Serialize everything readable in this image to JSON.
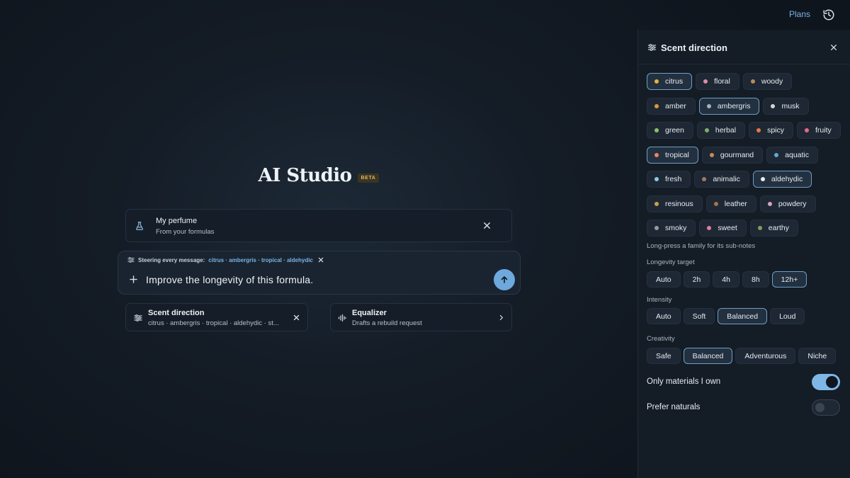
{
  "topbar": {
    "plans_label": "Plans",
    "history_icon": "history-icon"
  },
  "hero": {
    "title": "AI Studio",
    "badge": "BETA"
  },
  "perfume_card": {
    "title": "My perfume",
    "subtitle": "From your formulas",
    "icon": "flask-icon"
  },
  "composer": {
    "steer_label": "Steering every message:",
    "steer_values": "citrus · ambergris · tropical · aldehydic",
    "input_value": "Improve the longevity of this formula.",
    "send_icon": "arrow-up-icon"
  },
  "scent_card": {
    "title": "Scent direction",
    "subtitle": "citrus · ambergris · tropical · aldehydic · st..."
  },
  "equalizer_card": {
    "title": "Equalizer",
    "subtitle": "Drafts a rebuild request"
  },
  "panel": {
    "title": "Scent direction",
    "families": [
      [
        {
          "label": "citrus",
          "color": "#e3b341",
          "selected": true
        },
        {
          "label": "floral",
          "color": "#e08aa8",
          "selected": false
        },
        {
          "label": "woody",
          "color": "#b98a5e",
          "selected": false
        }
      ],
      [
        {
          "label": "amber",
          "color": "#d99a3e",
          "selected": false
        },
        {
          "label": "ambergris",
          "color": "#9fb4c6",
          "selected": true
        },
        {
          "label": "musk",
          "color": "#d8d3cc",
          "selected": false
        }
      ],
      [
        {
          "label": "green",
          "color": "#8cc06a",
          "selected": false
        },
        {
          "label": "herbal",
          "color": "#7fae6a",
          "selected": false
        },
        {
          "label": "spicy",
          "color": "#e0794a",
          "selected": false
        },
        {
          "label": "fruity",
          "color": "#e66a7e",
          "selected": false
        }
      ],
      [
        {
          "label": "tropical",
          "color": "#e88466",
          "selected": true
        },
        {
          "label": "gourmand",
          "color": "#c98a56",
          "selected": false
        },
        {
          "label": "aquatic",
          "color": "#5fa8d8",
          "selected": false
        }
      ],
      [
        {
          "label": "fresh",
          "color": "#8ec9e6",
          "selected": false
        },
        {
          "label": "animalic",
          "color": "#a07a62",
          "selected": false
        },
        {
          "label": "aldehydic",
          "color": "#e9edf2",
          "selected": true
        }
      ],
      [
        {
          "label": "resinous",
          "color": "#c7a04a",
          "selected": false
        },
        {
          "label": "leather",
          "color": "#a8704a",
          "selected": false
        },
        {
          "label": "powdery",
          "color": "#d7a3c6",
          "selected": false
        }
      ],
      [
        {
          "label": "smoky",
          "color": "#9a9a9a",
          "selected": false
        },
        {
          "label": "sweet",
          "color": "#e27f9e",
          "selected": false
        },
        {
          "label": "earthy",
          "color": "#8a9a5e",
          "selected": false
        }
      ]
    ],
    "hint": "Long-press a family for its sub-notes",
    "longevity": {
      "label": "Longevity target",
      "options": [
        "Auto",
        "2h",
        "4h",
        "8h",
        "12h+"
      ],
      "selected": "12h+"
    },
    "intensity": {
      "label": "Intensity",
      "options": [
        "Auto",
        "Soft",
        "Balanced",
        "Loud"
      ],
      "selected": "Balanced"
    },
    "creativity": {
      "label": "Creativity",
      "options": [
        "Safe",
        "Balanced",
        "Adventurous",
        "Niche"
      ],
      "selected": "Balanced"
    },
    "toggles": [
      {
        "label": "Only materials I own",
        "on": true
      },
      {
        "label": "Prefer naturals",
        "on": false
      }
    ]
  },
  "colors": {
    "accent": "#79b4e6",
    "send_button": "#6ea8dc",
    "toggle_on": "#7eb6e6"
  }
}
